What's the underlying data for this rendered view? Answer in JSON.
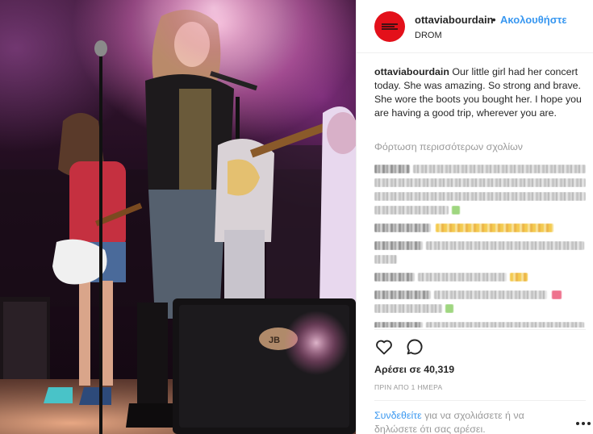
{
  "post": {
    "username": "ottaviabourdain",
    "separator": "•",
    "follow_label": "Ακολουθήστε",
    "location": "DROM",
    "caption_user": "ottaviabourdain",
    "caption_text": "Our little girl had her concert today. She was amazing. So strong and brave. She wore the boots you bought her. I hope you are having a good trip, wherever you are.",
    "load_more_label": "Φόρτωση περισσότερων σχολίων",
    "likes_label": "Αρέσει σε 40,319",
    "timestamp": "ΠΡΙΝ ΑΠΟ 1 ΗΜΕΡΑ",
    "login_link": "Συνδεθείτε",
    "login_text": " για να σχολιάσετε ή να δηλώσετε ότι σας αρέσει."
  },
  "icons": {
    "like": "heart-icon",
    "comment": "comment-icon",
    "options": "more-options-icon"
  },
  "colors": {
    "link_blue": "#3897f0",
    "avatar_red": "#e3101a",
    "secondary_text": "#999999"
  }
}
